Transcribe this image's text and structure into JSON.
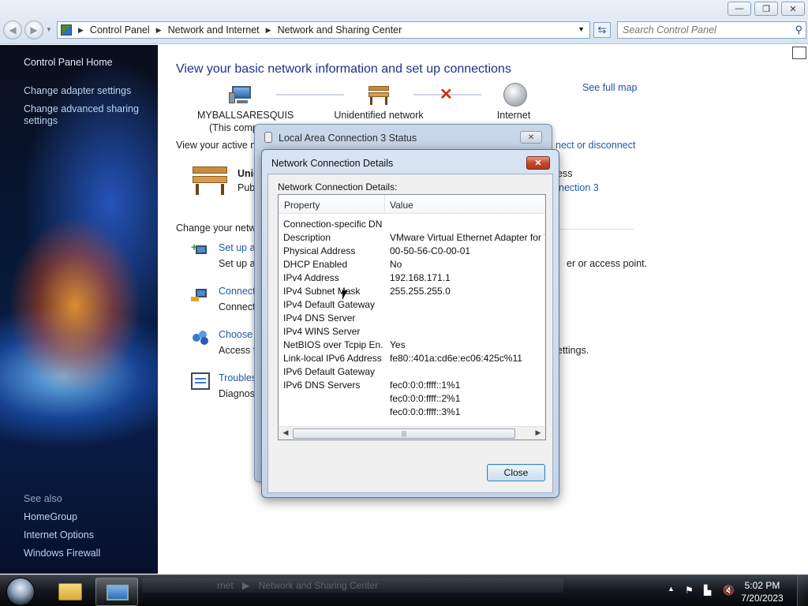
{
  "address_bar": {
    "crumbs": [
      "Control Panel",
      "Network and Internet",
      "Network and Sharing Center"
    ]
  },
  "search": {
    "placeholder": "Search Control Panel"
  },
  "window_buttons": {
    "minimize": "—",
    "restore": "❐",
    "close": "✕"
  },
  "left_pane": {
    "home": "Control Panel Home",
    "links": [
      "Change adapter settings",
      "Change advanced sharing",
      "settings"
    ],
    "see_also_title": "See also",
    "see_also": [
      "HomeGroup",
      "Internet Options",
      "Windows Firewall"
    ]
  },
  "main": {
    "title": "View your basic network information and set up connections",
    "see_full_map": "See full map",
    "nodes": [
      {
        "label": "MYBALLSARESQUIS",
        "sub": "(This comp"
      },
      {
        "label": "Unidentified network",
        "sub": ""
      },
      {
        "label": "Internet",
        "sub": ""
      }
    ],
    "active_networks_label": "View your active net",
    "connect_disconnect": "nect or disconnect",
    "network_name": "Unic",
    "network_type": "Pub",
    "access_type_suffix": "ess",
    "connection_link": "nection 3",
    "change_settings_label": "Change your netw",
    "tasks": [
      {
        "link": "Set up a",
        "desc": "Set up a",
        "desc_tail": "er or access point."
      },
      {
        "link": "Connect",
        "desc": "Connect",
        "desc_tail": ""
      },
      {
        "link": "Choose l",
        "desc": "Access fi",
        "desc_tail": "ettings."
      },
      {
        "link": "Troubles",
        "desc": "Diagnose",
        "desc_tail": ""
      }
    ]
  },
  "status_window": {
    "title": "Local Area Connection 3 Status",
    "close": "✕"
  },
  "details_dialog": {
    "title": "Network Connection Details",
    "close": "✕",
    "label": "Network Connection Details:",
    "columns": [
      "Property",
      "Value"
    ],
    "rows": [
      {
        "property": "Connection-specific DN...",
        "value": ""
      },
      {
        "property": "Description",
        "value": "VMware Virtual Ethernet Adapter for VMnet"
      },
      {
        "property": "Physical Address",
        "value": "00-50-56-C0-00-01"
      },
      {
        "property": "DHCP Enabled",
        "value": "No"
      },
      {
        "property": "IPv4 Address",
        "value": "192.168.171.1"
      },
      {
        "property": "IPv4 Subnet Mask",
        "value": "255.255.255.0"
      },
      {
        "property": "IPv4 Default Gateway",
        "value": ""
      },
      {
        "property": "IPv4 DNS Server",
        "value": ""
      },
      {
        "property": "IPv4 WINS Server",
        "value": ""
      },
      {
        "property": "NetBIOS over Tcpip En...",
        "value": "Yes"
      },
      {
        "property": "Link-local IPv6 Address",
        "value": "fe80::401a:cd6e:ec06:425c%11"
      },
      {
        "property": "IPv6 Default Gateway",
        "value": ""
      },
      {
        "property": "IPv6 DNS Servers",
        "value": "fec0:0:0:ffff::1%1"
      },
      {
        "property": "",
        "value": "fec0:0:0:ffff::2%1"
      },
      {
        "property": "",
        "value": "fec0:0:0:ffff::3%1"
      }
    ],
    "scroll_left": "◀",
    "scroll_right": "▶",
    "scroll_grip": "|||",
    "close_button": "Close"
  },
  "taskbar": {
    "ghost_text": "Network and Sharing Center",
    "ghost_prefix": "rnet",
    "clock_time": "5:02 PM",
    "clock_date": "7/20/2023",
    "tray_icons": [
      "show-hidden-icons",
      "action-center-flag-icon",
      "network-warning-icon",
      "volume-muted-icon"
    ]
  }
}
